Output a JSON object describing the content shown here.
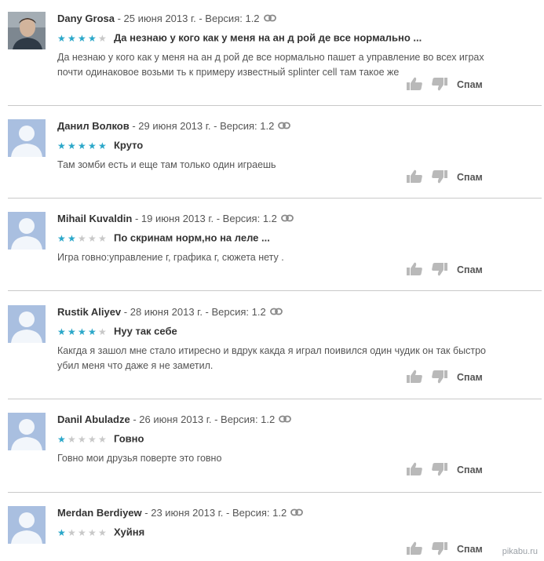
{
  "reviews": [
    {
      "author": "Dany Grosa",
      "meta": " - 25 июня 2013 г. - Версия: 1.2",
      "rating": 4,
      "title": "Да незнаю у кого как у меня на ан д рой де все нормально ...",
      "body": "Да незнаю у кого как у меня на ан д рой де все нормально пашет а управление во всех играх почти одинаковое возьми ть к примеру известный splinter cell там такое же",
      "avatar": "photo",
      "spam_label": "Спам"
    },
    {
      "author": "Данил Волков",
      "meta": " - 29 июня 2013 г. - Версия: 1.2",
      "rating": 5,
      "title": "Круто",
      "body": "Там зомби есть и еще там только один играешь",
      "avatar": "default",
      "spam_label": "Спам"
    },
    {
      "author": "Mihail Kuvaldin",
      "meta": " - 19 июня 2013 г. - Версия: 1.2",
      "rating": 2,
      "title": "По скринам норм,но на леле ...",
      "body": "Игра говно:управление г, графика г, сюжета нету .",
      "avatar": "default",
      "spam_label": "Спам"
    },
    {
      "author": "Rustik Aliyev",
      "meta": " - 28 июня 2013 г. - Версия: 1.2",
      "rating": 4,
      "title": "Нуу так себе",
      "body": "Какгда я зашол мне стало итиресно и вдрук какда я играл поивился один чудик он так быстро убил меня что даже я не заметил.",
      "avatar": "default",
      "spam_label": "Спам"
    },
    {
      "author": "Danil Abuladze",
      "meta": " - 26 июня 2013 г. - Версия: 1.2",
      "rating": 1,
      "title": "Говно",
      "body": "Говно мои друзья поверте это говно",
      "avatar": "default",
      "spam_label": "Спам"
    },
    {
      "author": "Merdan Berdiyew",
      "meta": " - 23 июня 2013 г. - Версия: 1.2",
      "rating": 1,
      "title": "Хуйня",
      "body": "",
      "avatar": "default",
      "spam_label": "Спам"
    }
  ],
  "colors": {
    "star_on": "#2aa7c9",
    "star_off": "#c8c8c8",
    "avatar_bg": "#a9bfe0",
    "divider": "#c9c9c9"
  },
  "watermark": "pikabu.ru"
}
